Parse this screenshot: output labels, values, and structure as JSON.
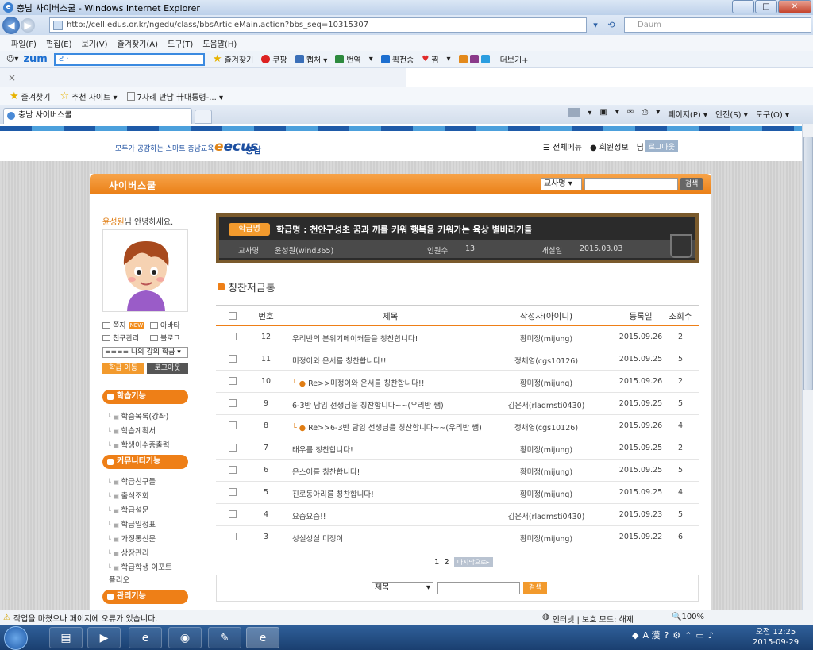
{
  "window": {
    "title": "충남 사이버스쿨 - Windows Internet Explorer",
    "min": "─",
    "max": "□",
    "close": "✕"
  },
  "address": {
    "url": "http://cell.edus.or.kr/ngedu/class/bbsArticleMain.action?bbs_seq=10315307",
    "search_placeholder": "Daum"
  },
  "menu": [
    "파일(F)",
    "편집(E)",
    "보기(V)",
    "즐겨찾기(A)",
    "도구(T)",
    "도움말(H)"
  ],
  "zum": {
    "logo": "zum",
    "search": "Ƨ ·",
    "items": [
      "즐겨찾기",
      "쿠팡",
      "캡처 ▾",
      "번역",
      "▾",
      "퀵전송",
      "찜",
      "▾",
      "더보기+"
    ]
  },
  "favbar": {
    "fav": "즐겨찾기",
    "suggest": "추천 사이트 ▾",
    "link": "7자례 만남 卄대통령-... ▾"
  },
  "tab": {
    "label": "충남 사이버스쿨"
  },
  "cmd": [
    "▾",
    "▾",
    "▾",
    "페이지(P) ▾",
    "안전(S) ▾",
    "도구(O) ▾"
  ],
  "site": {
    "slogan": "모두가 공감하는 스마트 충남교육",
    "logo": "ecus",
    "logo_region": "충남",
    "nav_menu": "☰ 전체메뉴",
    "nav_member": "● 회원정보",
    "nav_user": "님",
    "logout_top": "로그아웃"
  },
  "panel": {
    "title": "사이버스쿨",
    "search_select": "교사명 ▾",
    "search_btn": "검색"
  },
  "left": {
    "hello_name": "윤성원",
    "hello_text": "님 안녕하세요.",
    "links": {
      "mail": "쪽지",
      "new": "NEW",
      "avatar": "아바타",
      "friends": "친구관리",
      "blog": "블로그"
    },
    "class_select": "==== 나의 강의 학급 ▾",
    "btn_move": "학급 이동",
    "btn_logout": "로그아웃",
    "sections": [
      {
        "title": "학습기능",
        "items": [
          "학습목록(강좌)",
          "학습계획서",
          "학생이수증출력"
        ]
      },
      {
        "title": "커뮤니티기능",
        "items": [
          "학급친구들",
          "출석조회",
          "학급설문",
          "학급일정표",
          "가정통신문",
          "상장관리",
          "학급학생 이포트"
        ]
      },
      {
        "title": "관리기능",
        "items": []
      }
    ],
    "folio": "폴리오"
  },
  "board": {
    "label": "학급명",
    "class_name": "학급명 : 천안구성초 꿈과 끼를 키워 행복을 키워가는 육상 별바라기들",
    "teacher_label": "교사명",
    "teacher": "윤성원(wind365)",
    "members_label": "인원수",
    "members": "13",
    "opened_label": "개설일",
    "opened": "2015.03.03"
  },
  "section_title": "칭찬저금통",
  "table": {
    "headers": {
      "no": "번호",
      "title": "제목",
      "writer": "작성자(아이디)",
      "date": "등록일",
      "views": "조회수"
    },
    "rows": [
      {
        "no": "12",
        "title": "우리반의 분위기메이커들을 칭찬합니다!",
        "reply": false,
        "writer": "황미정(mijung)",
        "date": "2015.09.26",
        "views": "2"
      },
      {
        "no": "11",
        "title": "미정이와 은서를 칭찬합니다!!",
        "reply": false,
        "writer": "정채영(cgs10126)",
        "date": "2015.09.25",
        "views": "5"
      },
      {
        "no": "10",
        "title": "Re>>미정이와 은서를 칭찬합니다!!",
        "reply": true,
        "writer": "황미정(mijung)",
        "date": "2015.09.26",
        "views": "2"
      },
      {
        "no": "9",
        "title": "6-3반 담임 선생님을 칭찬합니다~~(우리반 쌤)",
        "reply": false,
        "writer": "김은서(rladmsti0430)",
        "date": "2015.09.25",
        "views": "5"
      },
      {
        "no": "8",
        "title": "Re>>6-3반 담임 선생님을 칭찬합니다~~(우리반 쌤)",
        "reply": true,
        "writer": "정채영(cgs10126)",
        "date": "2015.09.26",
        "views": "4"
      },
      {
        "no": "7",
        "title": "태우를 칭찬합니다!",
        "reply": false,
        "writer": "황미정(mijung)",
        "date": "2015.09.25",
        "views": "2"
      },
      {
        "no": "6",
        "title": "은스어를 칭찬합니다!",
        "reply": false,
        "writer": "황미정(mijung)",
        "date": "2015.09.25",
        "views": "5"
      },
      {
        "no": "5",
        "title": "진로동아리를 칭찬합니다!",
        "reply": false,
        "writer": "황미정(mijung)",
        "date": "2015.09.25",
        "views": "4"
      },
      {
        "no": "4",
        "title": "요즘요즘!!",
        "reply": false,
        "writer": "김은서(rladmsti0430)",
        "date": "2015.09.23",
        "views": "5"
      },
      {
        "no": "3",
        "title": "성실성실 미정이",
        "reply": false,
        "writer": "황미정(mijung)",
        "date": "2015.09.22",
        "views": "6"
      }
    ]
  },
  "pager": {
    "p1": "1",
    "p2": "2",
    "last": "마지막으로▸"
  },
  "bottom_search": {
    "select": "제목",
    "btn": "검색"
  },
  "status": {
    "text": "작업을 마쳤으나 페이지에 오류가 있습니다.",
    "zone": "인터넷 | 보호 모드: 해제",
    "zoom": "100%"
  },
  "tray": {
    "lang": "A 漢",
    "time": "오전 12:25",
    "date": "2015-09-29"
  }
}
